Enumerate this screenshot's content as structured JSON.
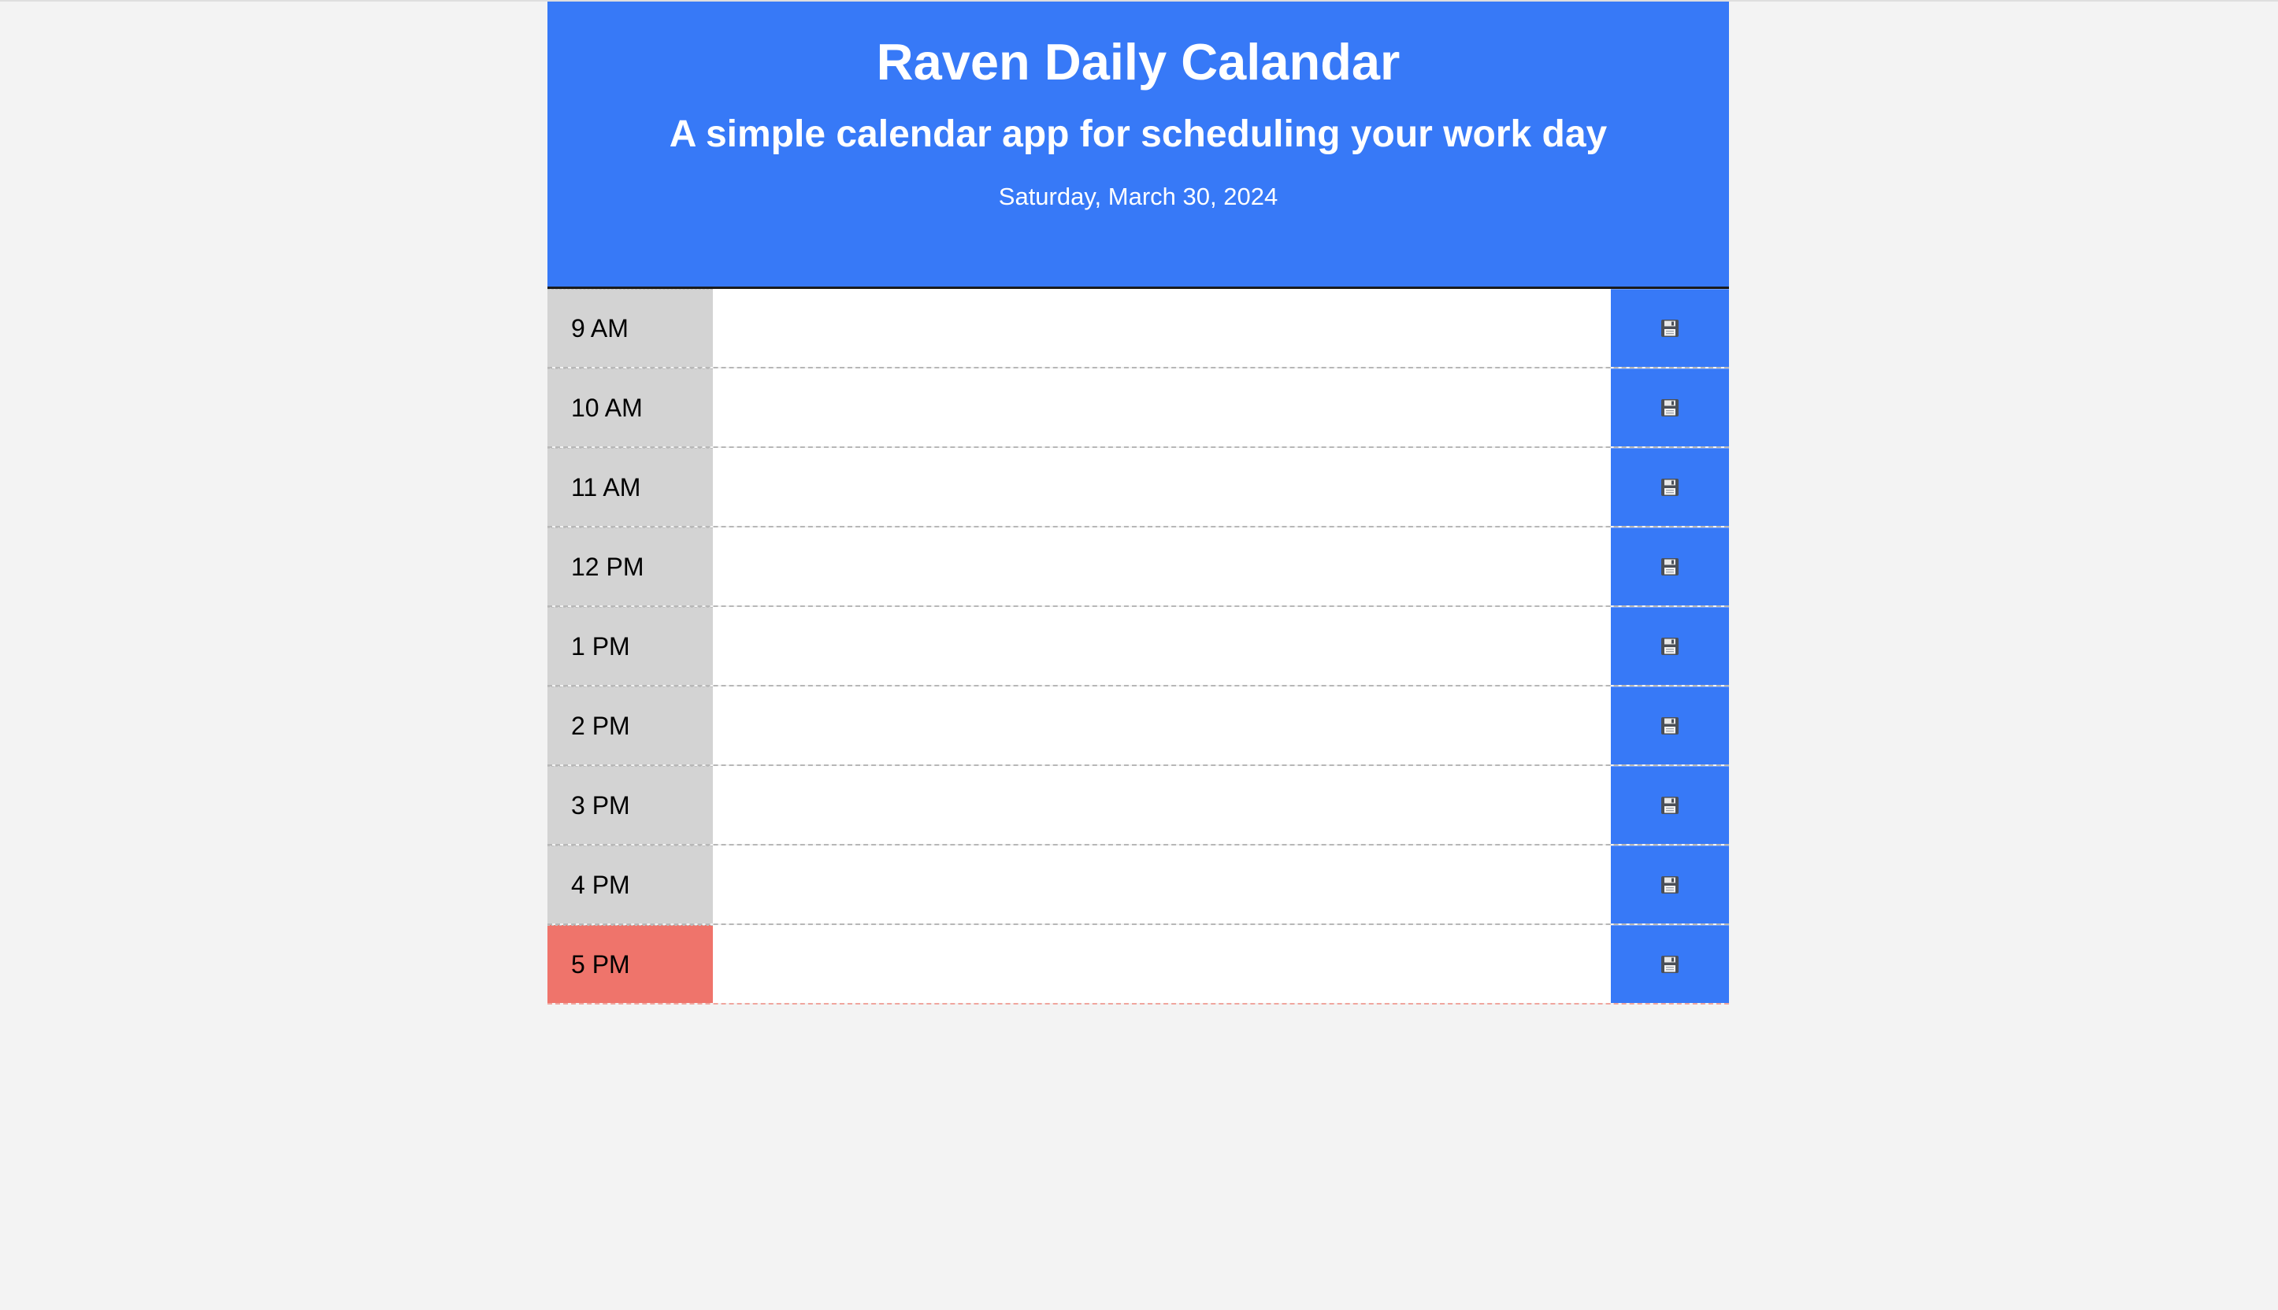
{
  "header": {
    "title": "Raven Daily Calandar",
    "subtitle": "A simple calendar app for scheduling your work day",
    "date": "Saturday, March 30, 2024"
  },
  "colors": {
    "accent": "#3779f7",
    "hour_past": "#d3d3d3",
    "hour_present": "#ef746b",
    "page_background": "#f3f3f3"
  },
  "icons": {
    "save": "floppy-disk-icon"
  },
  "timeblocks": [
    {
      "hour": "9 AM",
      "text": "",
      "state": "past"
    },
    {
      "hour": "10 AM",
      "text": "",
      "state": "past"
    },
    {
      "hour": "11 AM",
      "text": "",
      "state": "past"
    },
    {
      "hour": "12 PM",
      "text": "",
      "state": "past"
    },
    {
      "hour": "1 PM",
      "text": "",
      "state": "past"
    },
    {
      "hour": "2 PM",
      "text": "",
      "state": "past"
    },
    {
      "hour": "3 PM",
      "text": "",
      "state": "past"
    },
    {
      "hour": "4 PM",
      "text": "",
      "state": "past"
    },
    {
      "hour": "5 PM",
      "text": "",
      "state": "present"
    }
  ]
}
